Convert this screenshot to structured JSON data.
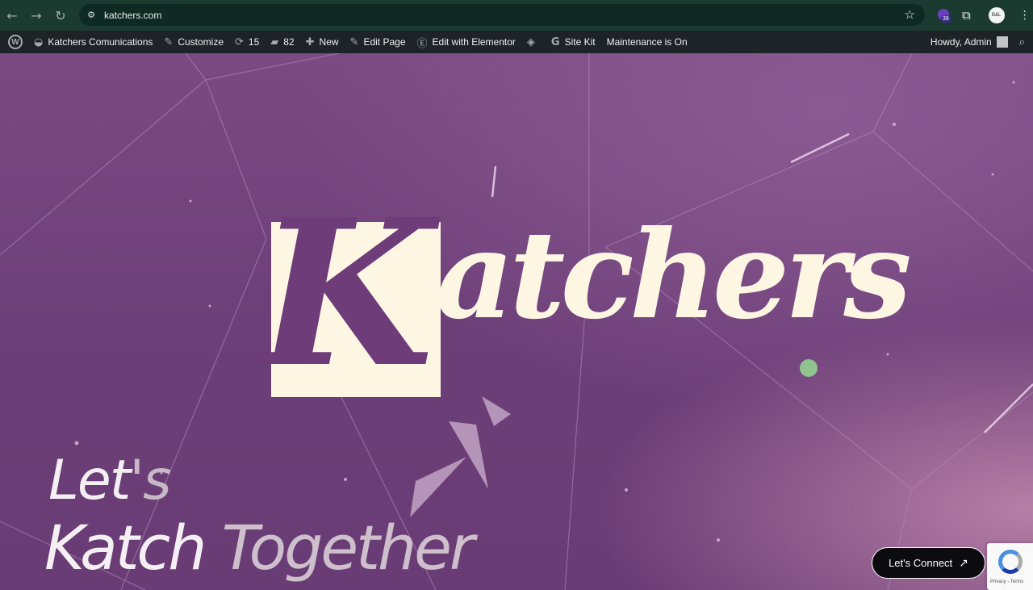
{
  "browser": {
    "url": "katchers.com",
    "extension_badge_count": "39",
    "profile_label": "B&L"
  },
  "adminbar": {
    "site_name": "Katchers Comunications",
    "customize": "Customize",
    "updates_count": "15",
    "comments_count": "82",
    "new": "New",
    "edit_page": "Edit Page",
    "edit_elementor": "Edit with Elementor",
    "site_kit": "Site Kit",
    "maintenance": "Maintenance is On",
    "howdy": "Howdy, Admin"
  },
  "hero": {
    "logo_k": "K",
    "logo_rest": "atchers",
    "tagline_line1_a": "Let",
    "tagline_line1_b": "'s",
    "tagline_line2_a": "Katch ",
    "tagline_line2_b": "Together",
    "cta_label": "Let's Connect",
    "recaptcha_text": "Privacy - Terms"
  },
  "colors": {
    "hero_bg": "#6d3f78",
    "logo_cream": "#fdf6e3",
    "dot_green": "#8fc48e",
    "chrome_bg": "#1b3b31",
    "adminbar_bg": "#1d2327"
  }
}
